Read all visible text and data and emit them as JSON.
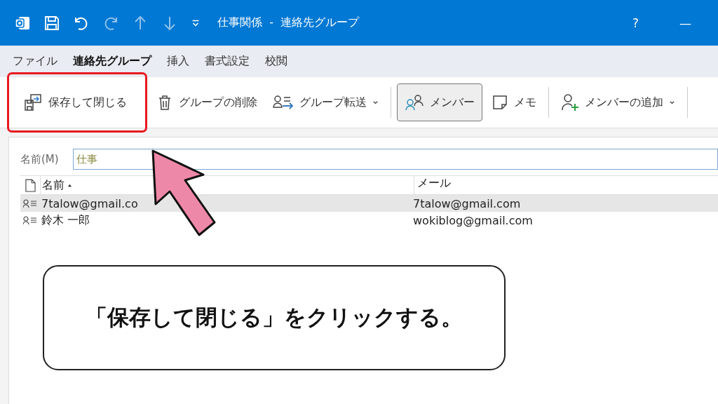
{
  "window": {
    "title": "仕事関係  -  連絡先グループ",
    "help": "?",
    "minimize": "—"
  },
  "menu_tabs": [
    {
      "label": "ファイル",
      "selected": false
    },
    {
      "label": "連絡先グループ",
      "selected": true
    },
    {
      "label": "挿入",
      "selected": false
    },
    {
      "label": "書式設定",
      "selected": false
    },
    {
      "label": "校閲",
      "selected": false
    }
  ],
  "ribbon": [
    {
      "kind": "save-close",
      "label": "保存して閉じる",
      "highlighted": true,
      "pressed": false,
      "dropdown": false
    },
    {
      "kind": "delete",
      "label": "グループの削除",
      "highlighted": false,
      "pressed": false,
      "dropdown": false
    },
    {
      "kind": "forward",
      "label": "グループ転送",
      "highlighted": false,
      "pressed": false,
      "dropdown": true
    },
    {
      "kind": "members",
      "label": "メンバー",
      "highlighted": false,
      "pressed": true,
      "dropdown": false
    },
    {
      "kind": "memo",
      "label": "メモ",
      "highlighted": false,
      "pressed": false,
      "dropdown": false
    },
    {
      "kind": "add-member",
      "label": "メンバーの追加",
      "highlighted": false,
      "pressed": false,
      "dropdown": true
    }
  ],
  "name_field": {
    "label": "名前(M)",
    "value": "仕事"
  },
  "table": {
    "columns": [
      "名前",
      "メール"
    ],
    "rows": [
      {
        "name": "7talow@gmail.co",
        "email": "7talow@gmail.com",
        "selected": true
      },
      {
        "name": "鈴木 一郎",
        "email": "wokiblog@gmail.com",
        "selected": false
      }
    ]
  },
  "callout": {
    "text": "「保存して閉じる」をクリックする。"
  }
}
